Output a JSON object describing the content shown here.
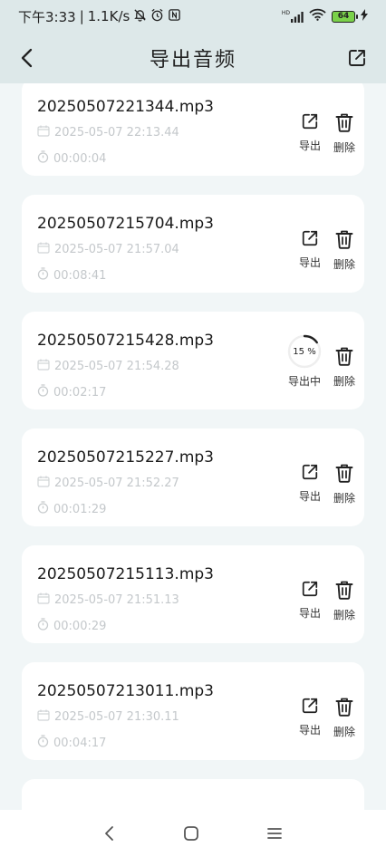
{
  "status": {
    "time": "下午3:33",
    "network_speed": "1.1K/s",
    "network_type": "HD",
    "battery_level": "64",
    "icons": [
      "mute-bell-icon",
      "alarm-icon",
      "nfc-icon",
      "signal-icon",
      "wifi-icon",
      "battery-icon",
      "charging-icon"
    ]
  },
  "header": {
    "title": "导出音频",
    "back_icon": "chevron-left-icon",
    "share_icon": "export-icon"
  },
  "actions": {
    "export_label": "导出",
    "delete_label": "删除",
    "exporting_label": "导出中"
  },
  "recordings": [
    {
      "name": "20250507221344.mp3",
      "date": "2025-05-07 22:13.44",
      "duration": "00:00:04",
      "state": "ready"
    },
    {
      "name": "20250507215704.mp3",
      "date": "2025-05-07 21:57.04",
      "duration": "00:08:41",
      "state": "ready"
    },
    {
      "name": "20250507215428.mp3",
      "date": "2025-05-07 21:54.28",
      "duration": "00:02:17",
      "state": "exporting",
      "progress_percent": 15,
      "progress_text": "15 %"
    },
    {
      "name": "20250507215227.mp3",
      "date": "2025-05-07 21:52.27",
      "duration": "00:01:29",
      "state": "ready"
    },
    {
      "name": "20250507215113.mp3",
      "date": "2025-05-07 21:51.13",
      "duration": "00:00:29",
      "state": "ready"
    },
    {
      "name": "20250507213011.mp3",
      "date": "2025-05-07 21:30.11",
      "duration": "00:04:17",
      "state": "ready"
    }
  ],
  "colors": {
    "header_bg": "#dde8e9",
    "page_bg": "#f1f6f7",
    "card_bg": "#ffffff",
    "meta_text": "#c4c8cb",
    "battery_fill": "#7ad14a"
  },
  "nav": {
    "icons": [
      "nav-back-icon",
      "nav-home-icon",
      "nav-menu-icon"
    ]
  }
}
